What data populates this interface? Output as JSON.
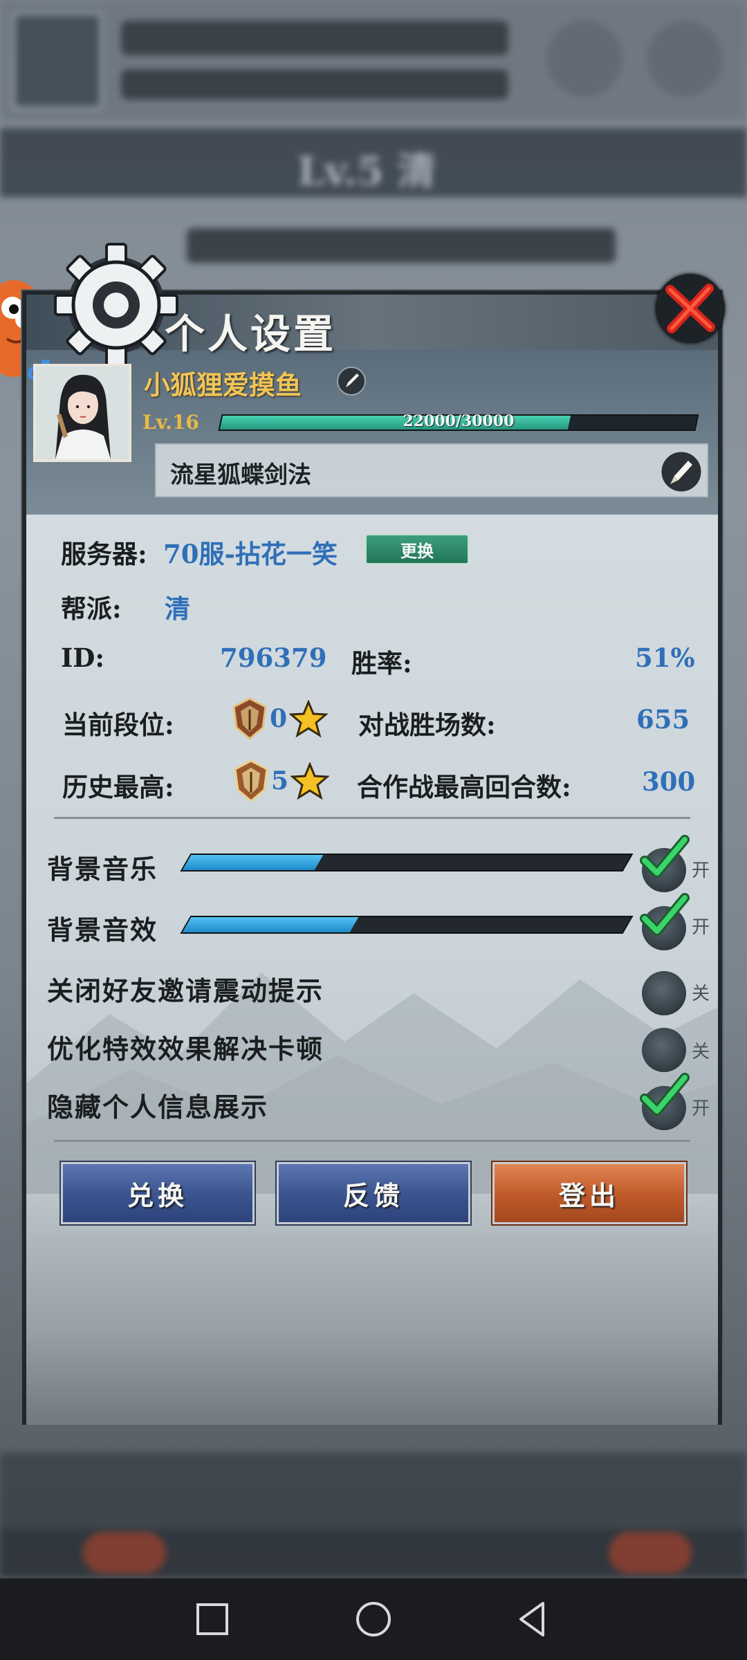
{
  "dialog": {
    "title": "个人设置",
    "player_name": "小狐狸爱摸鱼",
    "level": "Lv.16",
    "exp_text": "22000/30000",
    "exp_fraction": 0.733,
    "title_name": "流星狐蝶剑法"
  },
  "info": {
    "server_label": "服务器:",
    "server_value": "70服-拈花一笑",
    "change_label": "更换",
    "guild_label": "帮派:",
    "guild_value": "清",
    "id_label": "ID:",
    "id_value": "796379",
    "winrate_label": "胜率:",
    "winrate_value": "51%",
    "current_rank_label": "当前段位:",
    "current_rank_value": "0",
    "battle_wins_label": "对战胜场数:",
    "battle_wins_value": "655",
    "history_high_label": "历史最高:",
    "history_high_value": "5",
    "coop_rounds_label": "合作战最高回合数:",
    "coop_rounds_value": "300"
  },
  "settings": {
    "bgm_label": "背景音乐",
    "bgm_level": 0.3,
    "bgm_state": "开",
    "sfx_label": "背景音效",
    "sfx_level": 0.38,
    "sfx_state": "开",
    "friend_vibrate_label": "关闭好友邀请震动提示",
    "friend_vibrate_state": "关",
    "optimize_label": "优化特效效果解决卡顿",
    "optimize_state": "关",
    "hide_info_label": "隐藏个人信息展示",
    "hide_info_state": "开"
  },
  "buttons": {
    "redeem": "兑换",
    "feedback": "反馈",
    "logout": "登出"
  },
  "background": {
    "level_banner": "Lv.5 清"
  },
  "colors": {
    "name_gold": "#f1c454",
    "value_blue": "#2f6fb8",
    "slider_blue": "#36a8e0",
    "button_blue": "#3c5591",
    "button_orange": "#c25c2b",
    "check_green": "#2fc25a"
  }
}
